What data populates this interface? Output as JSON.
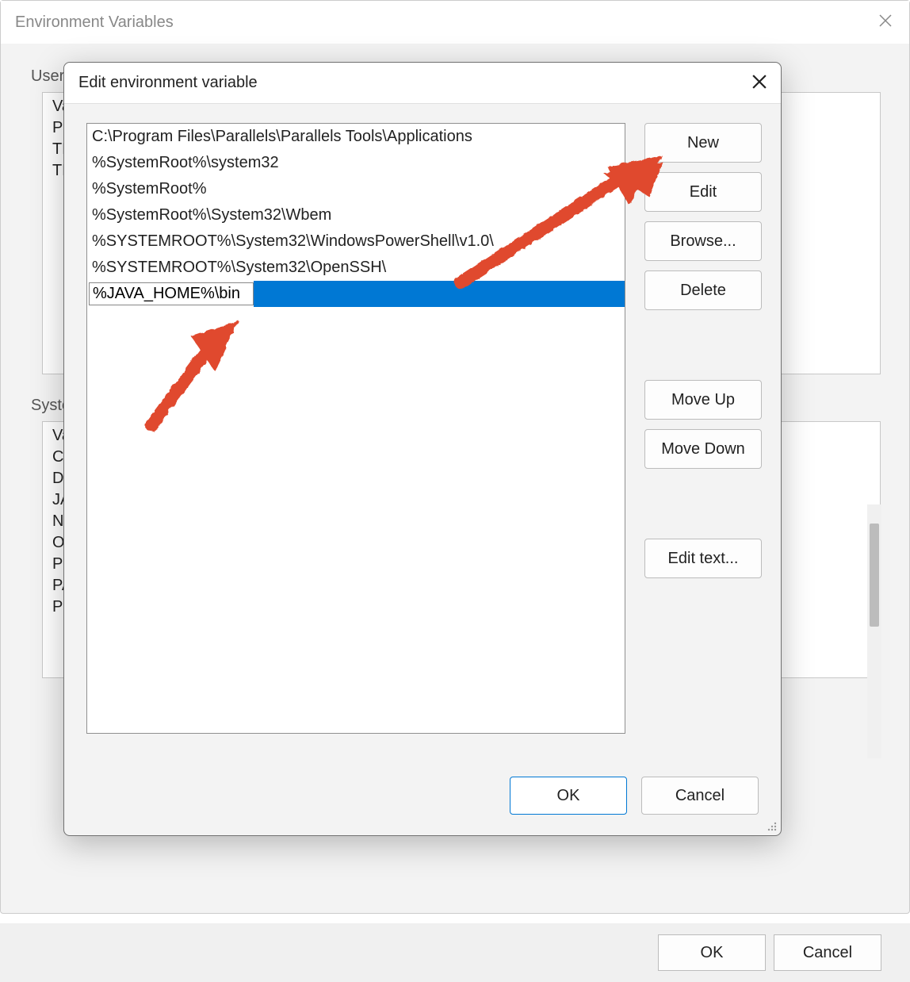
{
  "parent": {
    "title": "Environment Variables",
    "user_section_label": "User",
    "user_rows": [
      "Va",
      "Pat",
      "TE",
      "TM"
    ],
    "system_section_label": "Syste",
    "system_rows": [
      "Va",
      "Co",
      "Dri",
      "JA",
      "NU",
      "OS",
      "Pat",
      "PAT",
      "PR"
    ],
    "footer": {
      "ok": "OK",
      "cancel": "Cancel"
    }
  },
  "modal": {
    "title": "Edit environment variable",
    "path_entries": [
      "C:\\Program Files\\Parallels\\Parallels Tools\\Applications",
      "%SystemRoot%\\system32",
      "%SystemRoot%",
      "%SystemRoot%\\System32\\Wbem",
      "%SYSTEMROOT%\\System32\\WindowsPowerShell\\v1.0\\",
      "%SYSTEMROOT%\\System32\\OpenSSH\\"
    ],
    "editing_value": "%JAVA_HOME%\\bin",
    "buttons": {
      "new": "New",
      "edit": "Edit",
      "browse": "Browse...",
      "delete": "Delete",
      "move_up": "Move Up",
      "move_down": "Move Down",
      "edit_text": "Edit text..."
    },
    "footer": {
      "ok": "OK",
      "cancel": "Cancel"
    }
  }
}
